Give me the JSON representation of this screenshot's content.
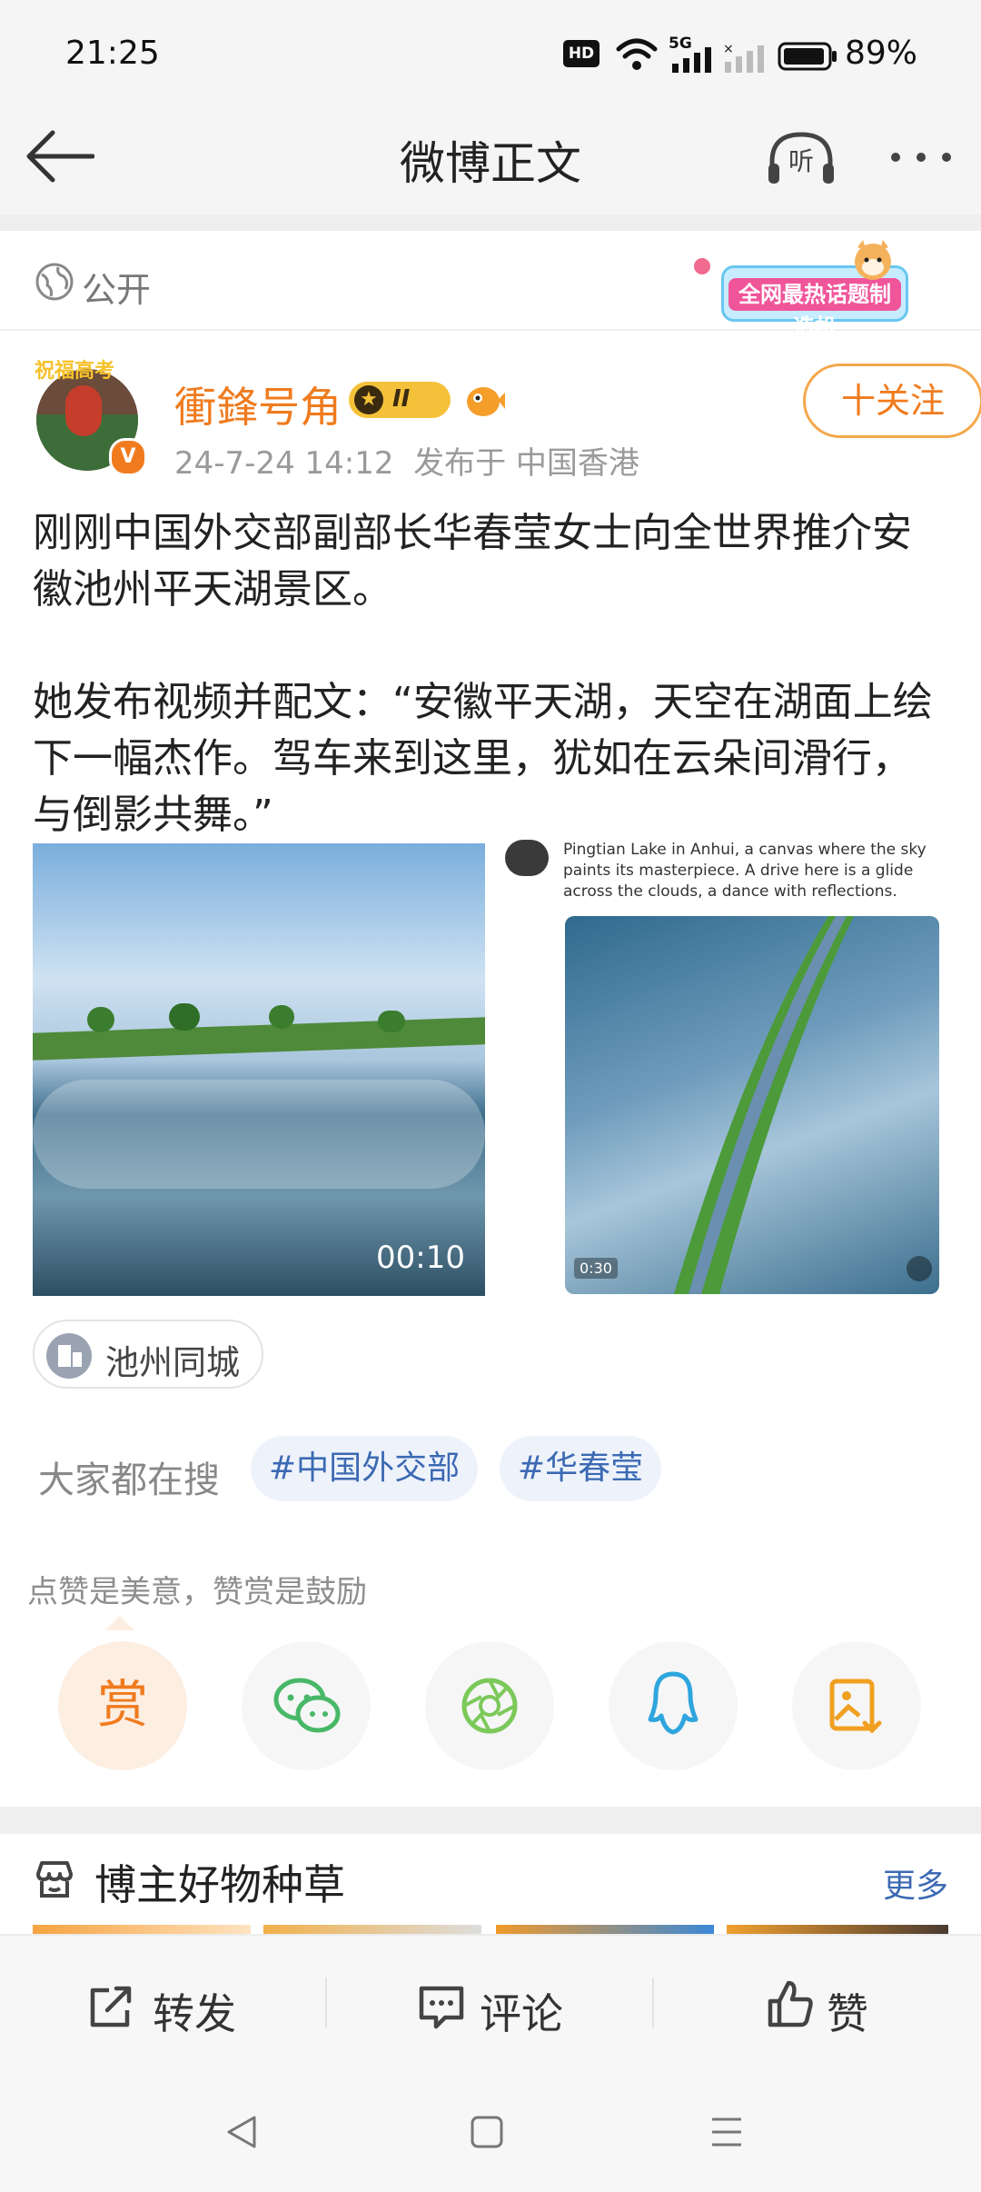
{
  "status_bar": {
    "time": "21:25",
    "hd_badge": "HD",
    "network": "5G",
    "battery": "89%"
  },
  "nav": {
    "title": "微博正文",
    "listen_label": "听"
  },
  "visibility": {
    "label": "公开",
    "banner_text": "全网最热话题制造机"
  },
  "post": {
    "avatar_badge_text": "祝福高考",
    "author": "衝鋒号角",
    "level_badge": "II",
    "timestamp": "24-7-24 14:12",
    "source": "发布于 中国香港",
    "follow_label": "十关注",
    "text": "刚刚中国外交部副部长华春莹女士向全世界推介安徽池州平天湖景区。\n\n她发布视频并配文：“安徽平天湖，天空在湖面上绘下一幅杰作。驾车来到这里，犹如在云朵间滑行，与倒影共舞。”",
    "video1_duration": "00:10",
    "video2_caption_line1": "Pingtian Lake in Anhui, a canvas where the sky",
    "video2_caption_line2": "paints its masterpiece. A drive here is a glide",
    "video2_caption_line3": "across the clouds, a dance with reflections.",
    "video2_duration": "0:30"
  },
  "location": {
    "label": "池州同城"
  },
  "search": {
    "label": "大家都在搜",
    "tags": [
      "#中国外交部",
      "#华春莹"
    ]
  },
  "reward": {
    "hint": "点赞是美意，赞赏是鼓励",
    "reward_label": "赏"
  },
  "section": {
    "title": "博主好物种草",
    "more": "更多"
  },
  "actions": {
    "repost": "转发",
    "comment": "评论",
    "like": "赞"
  },
  "colors": {
    "accent_orange": "#f07b1e",
    "link_blue": "#3c6ab3"
  }
}
